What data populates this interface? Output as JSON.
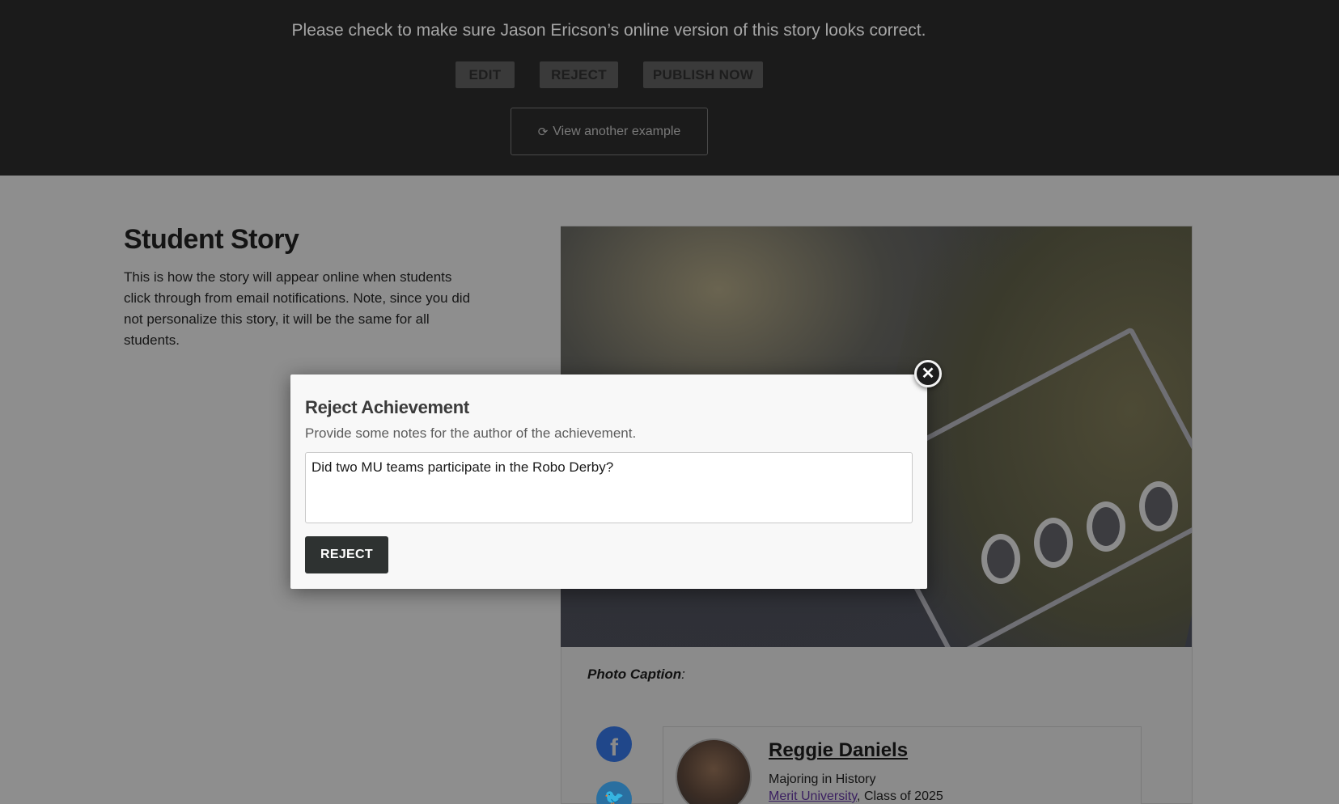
{
  "header": {
    "message": "Please check to make sure Jason Ericson’s online version of this story looks correct.",
    "buttons": {
      "edit": "EDIT",
      "reject": "REJECT",
      "publish": "PUBLISH NOW"
    },
    "view_example": {
      "icon": "refresh-icon",
      "label": "View another example"
    }
  },
  "story": {
    "title": "Student Story",
    "description": "This is how the story will appear online when students click through from email notifications. Note, since you did not personalize this story, it will be the same for all students.",
    "photo_caption_label": "Photo Caption",
    "photo_caption_colon": ":"
  },
  "profile": {
    "name": "Reggie Daniels",
    "major": "Majoring in History",
    "school": "Merit University",
    "class_suffix": ", Class of 2025"
  },
  "social": {
    "facebook_icon": "facebook-icon",
    "twitter_icon": "twitter-icon"
  },
  "modal": {
    "title": "Reject Achievement",
    "subtitle": "Provide some notes for the author of the achievement.",
    "notes_value": "Did two MU teams participate in the Robo Derby?",
    "reject_label": "REJECT",
    "close_icon": "close-icon"
  },
  "colors": {
    "header_bg": "#1b1b1b",
    "overlay_bg": "#8e8e8e",
    "modal_bg": "#f8f8f8",
    "reject_button_bg": "#2e3231",
    "facebook": "#20478a",
    "twitter": "#2a6fa0",
    "link": "#3a1f60"
  }
}
